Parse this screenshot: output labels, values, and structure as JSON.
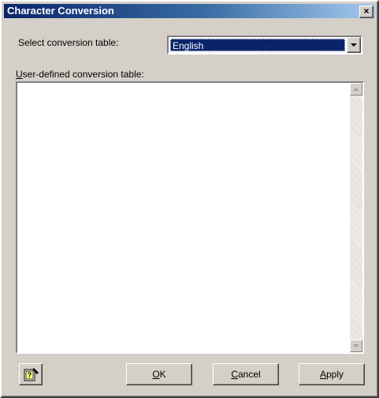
{
  "window": {
    "title": "Character Conversion",
    "close_glyph": "×"
  },
  "form": {
    "select_label": "Select conversion table:",
    "select_value": "English",
    "user_table_label_first": "U",
    "user_table_label_rest": "ser-defined conversion table:",
    "user_table_content": ""
  },
  "buttons": {
    "ok_first": "O",
    "ok_rest": "K",
    "cancel_first": "C",
    "cancel_rest": "ancel",
    "apply_first": "A",
    "apply_rest": "pply"
  },
  "icons": {
    "help": "help-icon",
    "close": "close-icon",
    "dropdown": "chevron-down-icon"
  },
  "colors": {
    "titlebar_start": "#0a246a",
    "titlebar_end": "#a6caf0",
    "face": "#d4d0c8",
    "selection": "#0a246a"
  }
}
